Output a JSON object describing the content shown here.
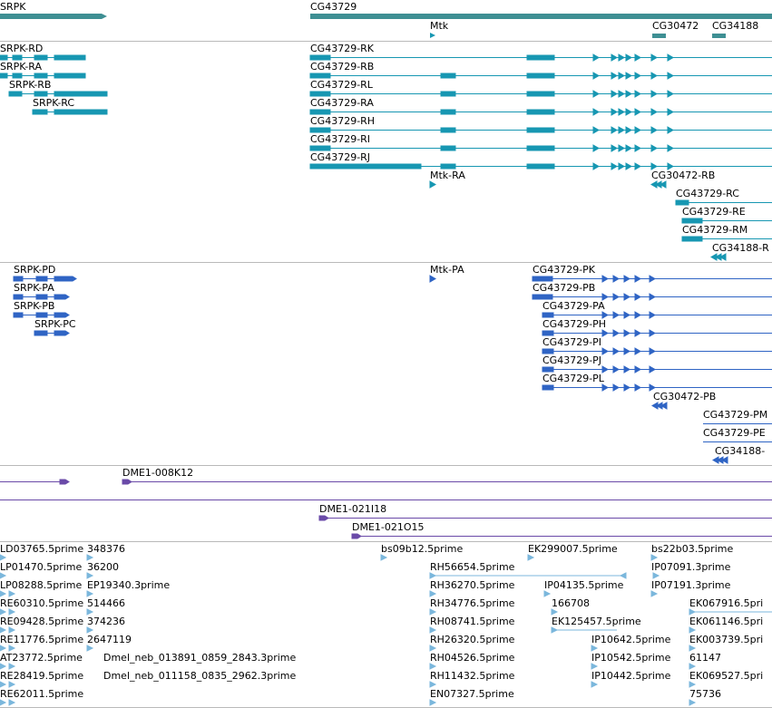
{
  "colors": {
    "gene": "#3e8f93",
    "transcript": "#1797b2",
    "protein": "#2f64c4",
    "clone": "#6a4aa8",
    "est": "#7bb7dc",
    "divider": "#b9b9b9"
  },
  "gene_track": {
    "labels": [
      "SRPK",
      "CG43729",
      "Mtk",
      "CG30472",
      "CG34188"
    ]
  },
  "transcript_track": {
    "labels": [
      "SRPK-RD",
      "SRPK-RA",
      "SRPK-RB",
      "SRPK-RC",
      "CG43729-RK",
      "CG43729-RB",
      "CG43729-RL",
      "CG43729-RA",
      "CG43729-RH",
      "CG43729-RI",
      "CG43729-RJ",
      "Mtk-RA",
      "CG30472-RB",
      "CG43729-RC",
      "CG43729-RE",
      "CG43729-RM",
      "CG34188-R"
    ]
  },
  "protein_track": {
    "labels": [
      "SRPK-PD",
      "SRPK-PA",
      "SRPK-PB",
      "SRPK-PC",
      "Mtk-PA",
      "CG43729-PK",
      "CG43729-PB",
      "CG43729-PA",
      "CG43729-PH",
      "CG43729-PI",
      "CG43729-PJ",
      "CG43729-PL",
      "CG30472-PB",
      "CG43729-PM",
      "CG43729-PE",
      "CG34188-"
    ]
  },
  "clone_track": {
    "labels": [
      "DME1-008K12",
      "DME1-021I18",
      "DME1-021O15"
    ]
  },
  "est_track": {
    "labels": [
      "LD03765.5prime",
      "348376",
      "LP01470.5prime",
      "36200",
      "LP08288.5prime",
      "EP19340.3prime",
      "RE60310.5prime",
      "514466",
      "RE09428.5prime",
      "374236",
      "RE11776.5prime",
      "2647119",
      "AT23772.5prime",
      "Dmel_neb_013891_0859_2843.3prime",
      "RE28419.5prime",
      "Dmel_neb_011158_0835_2962.3prime",
      "RE62011.5prime",
      "bs09b12.5prime",
      "EK299007.5prime",
      "bs22b03.5prime",
      "RH56654.5prime",
      "IP07091.3prime",
      "RH36270.5prime",
      "IP04135.5prime",
      "IP07191.3prime",
      "RH34776.5prime",
      "166708",
      "EK067916.5pri",
      "RH08741.5prime",
      "EK125457.5prime",
      "EK061146.5pri",
      "RH26320.5prime",
      "IP10642.5prime",
      "EK003739.5pri",
      "RH04526.5prime",
      "IP10542.5prime",
      "61147",
      "RH11432.5prime",
      "IP10442.5prime",
      "EK069527.5pri",
      "EN07327.5prime",
      "75736"
    ]
  }
}
